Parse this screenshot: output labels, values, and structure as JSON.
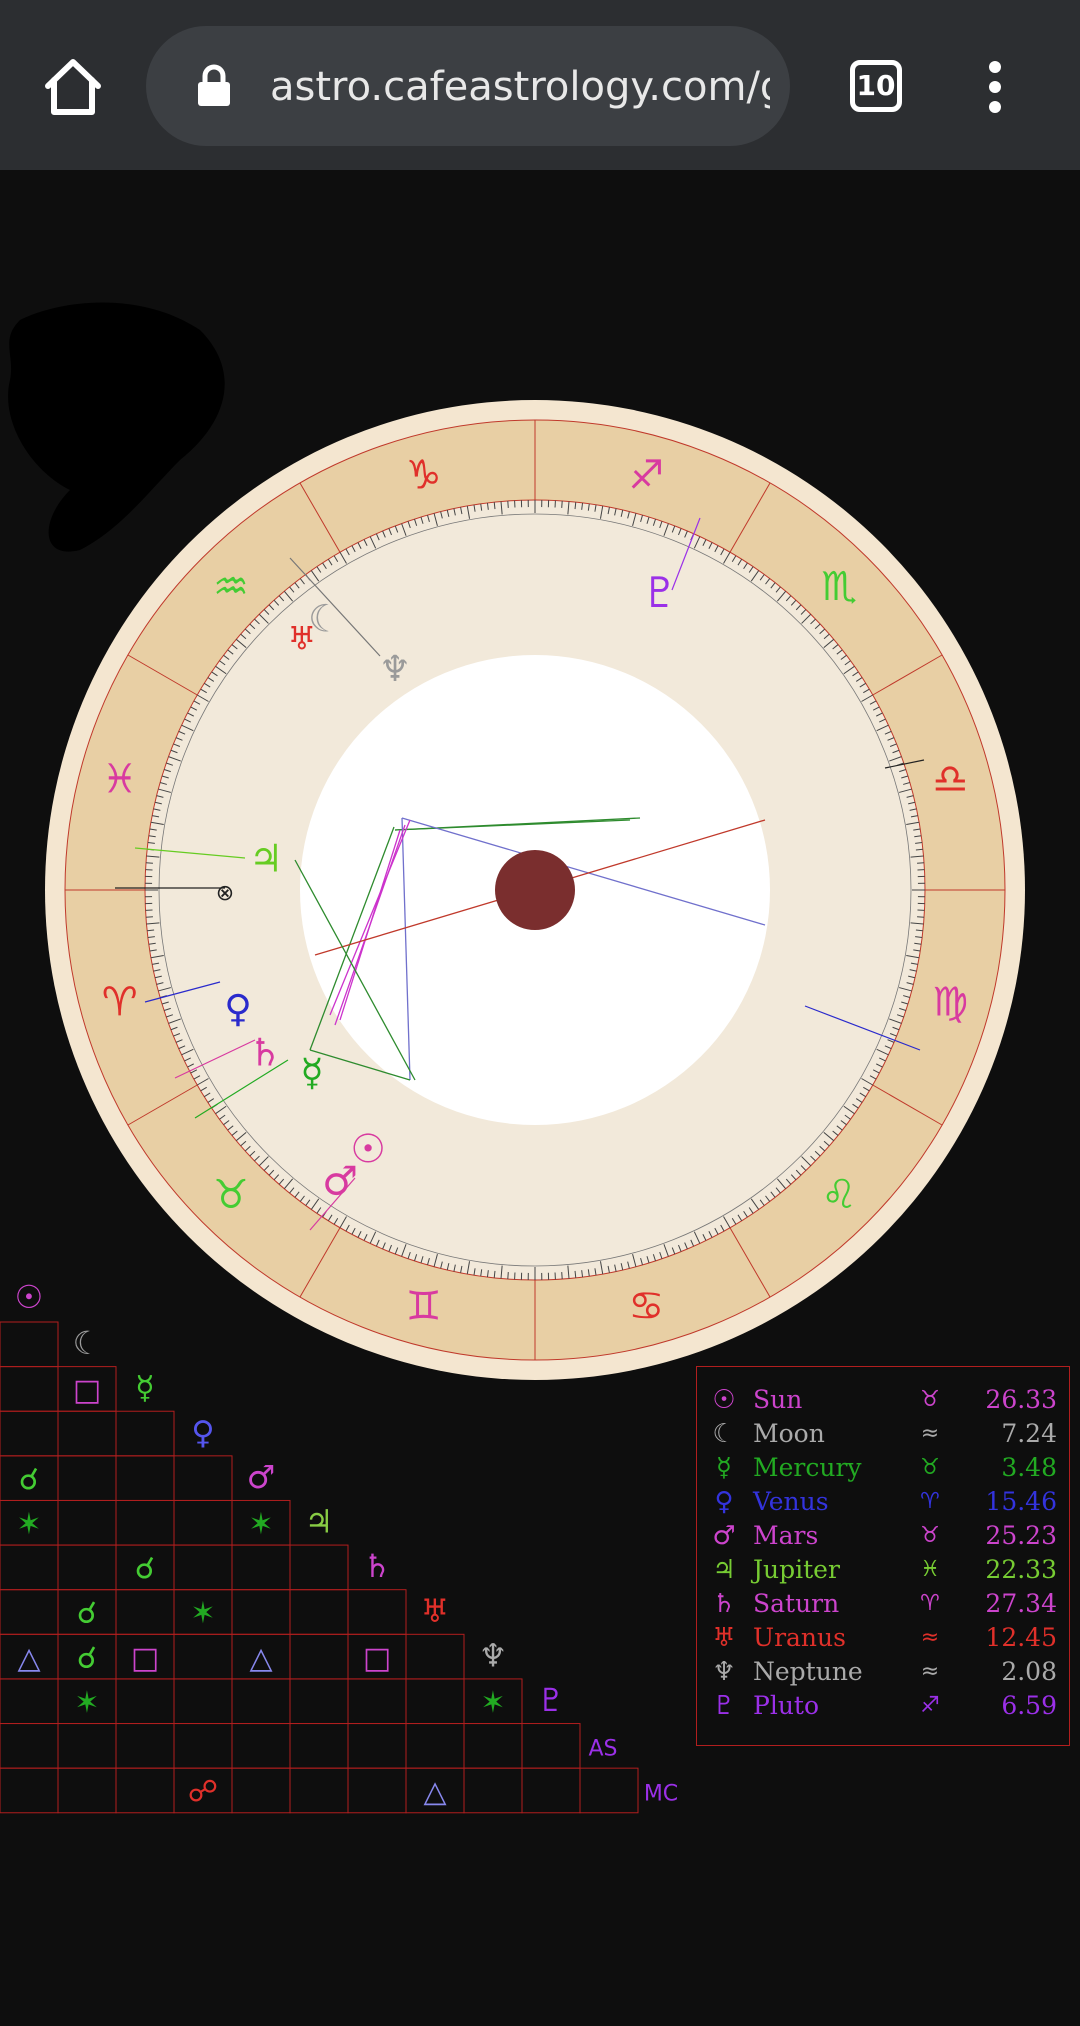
{
  "browser": {
    "url": "astro.cafeastrology.com/g",
    "tab_count": "10",
    "icons": {
      "home": "home-icon",
      "lock": "lock-icon",
      "tabs": "tab-switcher-icon",
      "menu": "more-vert-icon"
    }
  },
  "wheel": {
    "signs": [
      {
        "glyph": "♑",
        "color": "#e0302a"
      },
      {
        "glyph": "♐",
        "color": "#d83aa0"
      },
      {
        "glyph": "♏",
        "color": "#44cc33"
      },
      {
        "glyph": "♎",
        "color": "#e0302a"
      },
      {
        "glyph": "♍",
        "color": "#d83aa0"
      },
      {
        "glyph": "♌",
        "color": "#44cc33"
      },
      {
        "glyph": "♋",
        "color": "#e0302a"
      },
      {
        "glyph": "♊",
        "color": "#d83aa0"
      },
      {
        "glyph": "♉",
        "color": "#44cc33"
      },
      {
        "glyph": "♈",
        "color": "#e0302a"
      },
      {
        "glyph": "♓",
        "color": "#d83aa0"
      },
      {
        "glyph": "♒",
        "color": "#44cc33"
      }
    ],
    "planets": [
      {
        "name": "Pluto",
        "glyph": "♇",
        "color": "#9b30e8"
      },
      {
        "name": "Neptune",
        "glyph": "♆",
        "color": "#9a9a9a"
      },
      {
        "name": "Moon",
        "glyph": "☾",
        "color": "#9a9a9a"
      },
      {
        "name": "Uranus",
        "glyph": "♅",
        "color": "#e0302a"
      },
      {
        "name": "Jupiter",
        "glyph": "♃",
        "color": "#66cc22"
      },
      {
        "name": "Part of Fortune",
        "glyph": "⊗",
        "color": "#222222"
      },
      {
        "name": "Venus",
        "glyph": "♀",
        "color": "#2a2acc"
      },
      {
        "name": "Saturn",
        "glyph": "♄",
        "color": "#d83aa0"
      },
      {
        "name": "Mercury",
        "glyph": "☿",
        "color": "#22aa22"
      },
      {
        "name": "Sun",
        "glyph": "☉",
        "color": "#d83aa0"
      },
      {
        "name": "Mars",
        "glyph": "♂",
        "color": "#d83aa0"
      }
    ]
  },
  "aspect_grid": {
    "column_heads": [
      {
        "glyph": "☉",
        "color": "#cc44cc"
      },
      {
        "glyph": "☾",
        "color": "#9a9a9a"
      },
      {
        "glyph": "☿",
        "color": "#44cc33"
      },
      {
        "glyph": "♀",
        "color": "#5555ee"
      },
      {
        "glyph": "♂",
        "color": "#cc44cc"
      },
      {
        "glyph": "♃",
        "color": "#88cc44"
      },
      {
        "glyph": "♄",
        "color": "#cc44cc"
      },
      {
        "glyph": "♅",
        "color": "#e0302a"
      },
      {
        "glyph": "♆",
        "color": "#aaaaaa"
      },
      {
        "glyph": "♇",
        "color": "#9b30e8"
      },
      {
        "glyph": "AS",
        "color": "#9b30e8"
      },
      {
        "glyph": "MC",
        "color": "#9b30e8"
      }
    ],
    "aspects": [
      {
        "row": 2,
        "col": 1,
        "glyph": "□",
        "color": "#cc44cc"
      },
      {
        "row": 4,
        "col": 0,
        "glyph": "☌",
        "color": "#44cc33"
      },
      {
        "row": 5,
        "col": 0,
        "glyph": "✶",
        "color": "#22aa22"
      },
      {
        "row": 5,
        "col": 4,
        "glyph": "✶",
        "color": "#22aa22"
      },
      {
        "row": 6,
        "col": 2,
        "glyph": "☌",
        "color": "#44cc33"
      },
      {
        "row": 7,
        "col": 1,
        "glyph": "☌",
        "color": "#44cc33"
      },
      {
        "row": 7,
        "col": 3,
        "glyph": "✶",
        "color": "#22aa22"
      },
      {
        "row": 8,
        "col": 0,
        "glyph": "△",
        "color": "#8888ee"
      },
      {
        "row": 8,
        "col": 1,
        "glyph": "☌",
        "color": "#44cc33"
      },
      {
        "row": 8,
        "col": 2,
        "glyph": "□",
        "color": "#cc44cc"
      },
      {
        "row": 8,
        "col": 4,
        "glyph": "△",
        "color": "#8888ee"
      },
      {
        "row": 8,
        "col": 6,
        "glyph": "□",
        "color": "#cc44cc"
      },
      {
        "row": 9,
        "col": 1,
        "glyph": "✶",
        "color": "#22aa22"
      },
      {
        "row": 9,
        "col": 8,
        "glyph": "✶",
        "color": "#22aa22"
      },
      {
        "row": 11,
        "col": 3,
        "glyph": "☍",
        "color": "#e0302a"
      },
      {
        "row": 11,
        "col": 7,
        "glyph": "△",
        "color": "#8888ee"
      }
    ]
  },
  "legend": {
    "rows": [
      {
        "glyph": "☉",
        "name": "Sun",
        "sign": "♉",
        "degree": "26.33",
        "color": "#cc44cc"
      },
      {
        "glyph": "☾",
        "name": "Moon",
        "sign": "≈",
        "degree": "7.24",
        "color": "#aaaaaa"
      },
      {
        "glyph": "☿",
        "name": "Mercury",
        "sign": "♉",
        "degree": "3.48",
        "color": "#22aa22"
      },
      {
        "glyph": "♀",
        "name": "Venus",
        "sign": "♈",
        "degree": "15.46",
        "color": "#3333dd"
      },
      {
        "glyph": "♂",
        "name": "Mars",
        "sign": "♉",
        "degree": "25.23",
        "color": "#cc44cc"
      },
      {
        "glyph": "♃",
        "name": "Jupiter",
        "sign": "♓",
        "degree": "22.33",
        "color": "#77cc33"
      },
      {
        "glyph": "♄",
        "name": "Saturn",
        "sign": "♈",
        "degree": "27.34",
        "color": "#cc44cc"
      },
      {
        "glyph": "♅",
        "name": "Uranus",
        "sign": "≈",
        "degree": "12.45",
        "color": "#e0302a"
      },
      {
        "glyph": "♆",
        "name": "Neptune",
        "sign": "≈",
        "degree": "2.08",
        "color": "#aaaaaa"
      },
      {
        "glyph": "♇",
        "name": "Pluto",
        "sign": "♐",
        "degree": "6.59",
        "color": "#9b30e8"
      }
    ]
  }
}
